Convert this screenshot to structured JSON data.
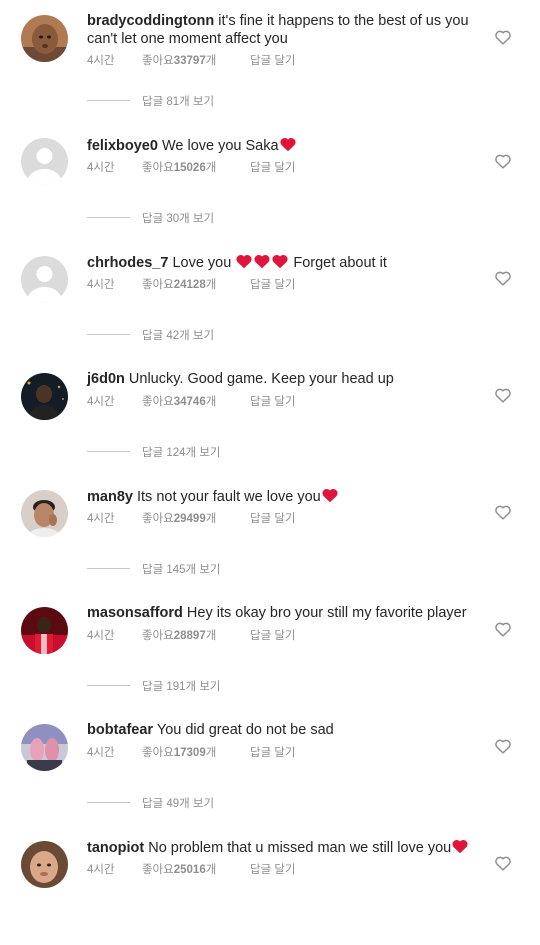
{
  "labels": {
    "time_ago": "4시간",
    "likes_prefix": "좋아요 ",
    "likes_suffix": "개",
    "reply": "답글 달기",
    "view_replies_prefix": "답글 ",
    "view_replies_suffix": "개 보기"
  },
  "colors": {
    "heart_emoji": "#e0143c",
    "meta_text": "#8e8e8e"
  },
  "comments": [
    {
      "username": "bradycoddingtonn",
      "text": "it's fine it happens to the best of us you can't let one moment affect you",
      "likes": "33797",
      "replies": "81"
    },
    {
      "username": "felixboye0",
      "text": "We love you Saka",
      "likes": "15026",
      "replies": "30"
    },
    {
      "username": "chrhodes_7",
      "text_before": "Love you ",
      "text_after": " Forget about it",
      "likes": "24128",
      "replies": "42"
    },
    {
      "username": "j6d0n",
      "text": "Unlucky. Good game. Keep your head up",
      "likes": "34746",
      "replies": "124"
    },
    {
      "username": "man8y",
      "text": "Its not your fault we love you",
      "likes": "29499",
      "replies": "145"
    },
    {
      "username": "masonsafford",
      "text": "Hey its okay bro your still my favorite player",
      "likes": "28897",
      "replies": "191"
    },
    {
      "username": "bobtafear",
      "text": "You did great do not be sad",
      "likes": "17309",
      "replies": "49"
    },
    {
      "username": "tanopiot",
      "text": "No problem that u missed man we still love you",
      "likes": "25016"
    }
  ]
}
